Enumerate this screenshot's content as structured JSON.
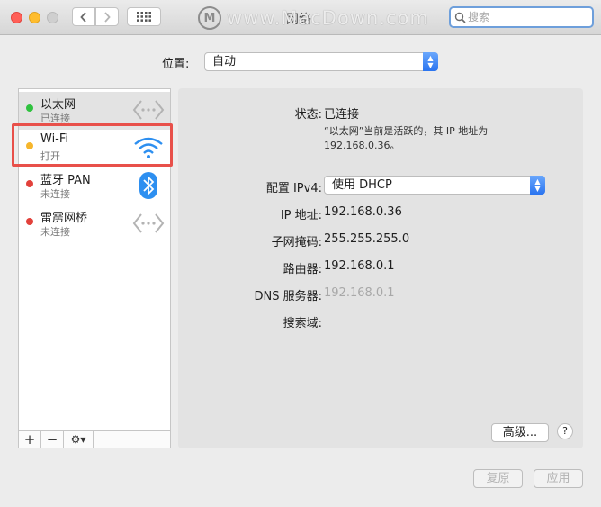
{
  "window": {
    "title": "网络",
    "watermark": "www.MacDown.com",
    "logo_letter": "M"
  },
  "search": {
    "placeholder": "搜索"
  },
  "location": {
    "label": "位置:",
    "value": "自动"
  },
  "services": [
    {
      "name": "以太网",
      "status": "已连接",
      "dot_color": "#2fc23f",
      "icon": "ethernet-icon"
    },
    {
      "name": "Wi-Fi",
      "status": "打开",
      "dot_color": "#f6b62c",
      "icon": "wifi-icon"
    },
    {
      "name": "蓝牙 PAN",
      "status": "未连接",
      "dot_color": "#e2413b",
      "icon": "bluetooth-icon"
    },
    {
      "name": "雷雳网桥",
      "status": "未连接",
      "dot_color": "#e2413b",
      "icon": "thunderbolt-bridge-icon"
    }
  ],
  "sidebar_toolbar": {
    "add": "+",
    "remove": "−",
    "gear": "⚙▾"
  },
  "detail": {
    "status_label": "状态:",
    "status_value": "已连接",
    "status_note": "“以太网”当前是活跃的，其 IP 地址为 192.168.0.36。",
    "configure_label": "配置 IPv4:",
    "configure_value": "使用 DHCP",
    "ip_label": "IP 地址:",
    "ip_value": "192.168.0.36",
    "mask_label": "子网掩码:",
    "mask_value": "255.255.255.0",
    "router_label": "路由器:",
    "router_value": "192.168.0.1",
    "dns_label": "DNS 服务器:",
    "dns_value": "192.168.0.1",
    "search_domain_label": "搜索域:"
  },
  "buttons": {
    "advanced": "高级...",
    "help": "?",
    "revert": "复原",
    "apply": "应用"
  }
}
